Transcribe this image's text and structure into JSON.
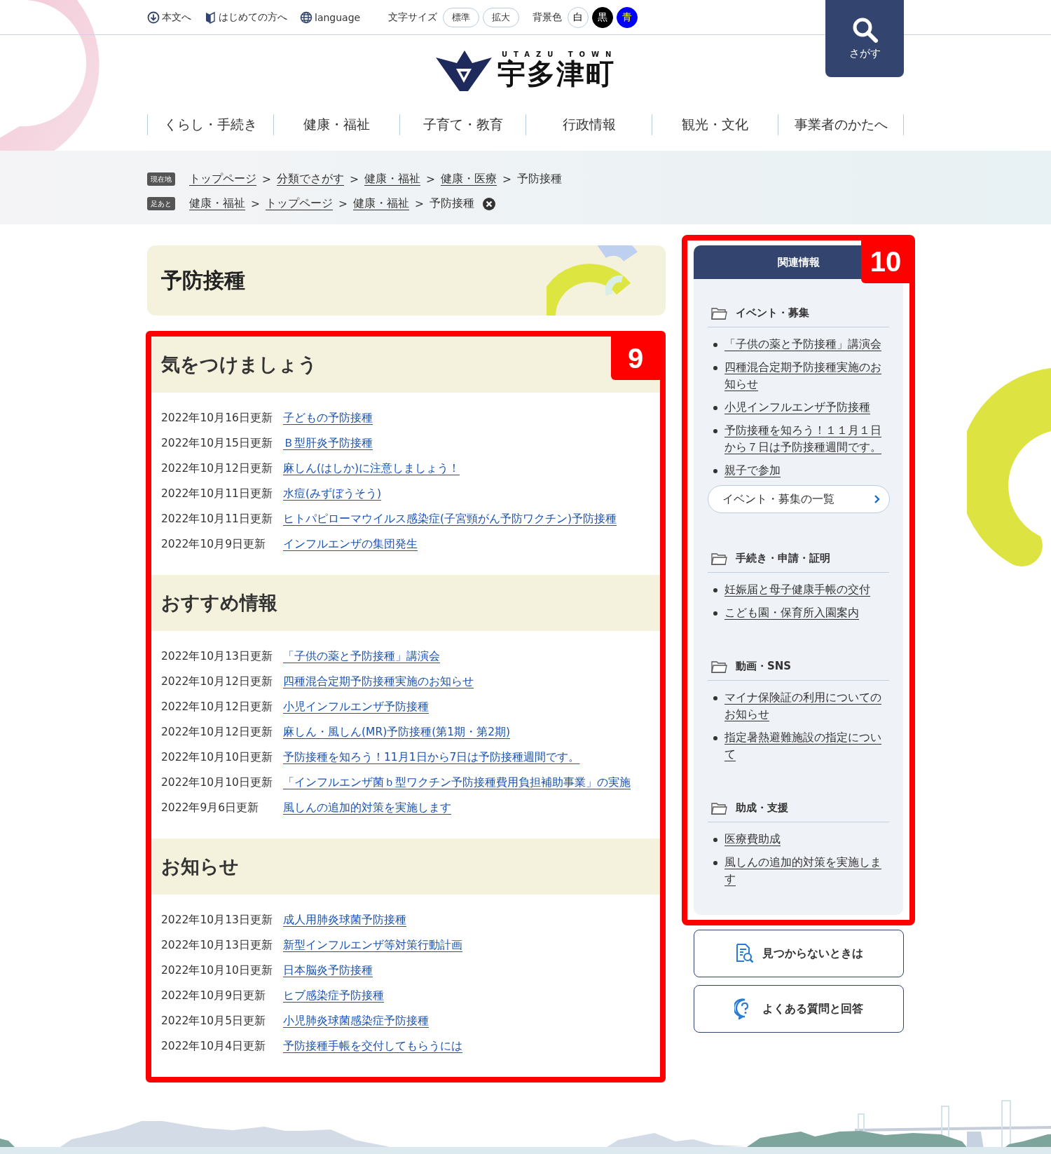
{
  "utility_bar": {
    "links": [
      {
        "label": "本文へ"
      },
      {
        "label": "はじめての方へ"
      },
      {
        "label": "language"
      }
    ],
    "font_size": {
      "label": "文字サイズ",
      "options": [
        {
          "label": "標準"
        },
        {
          "label": "拡大"
        }
      ]
    },
    "background_color": {
      "label": "背景色",
      "options": [
        {
          "label": "白",
          "color": "#ffffff"
        },
        {
          "label": "黒",
          "color": "#000000"
        },
        {
          "label": "青",
          "color": "#0000ff"
        }
      ]
    }
  },
  "search_button": {
    "label": "さがす"
  },
  "logo": {
    "tagline": "UTAZU TOWN",
    "name": "宇多津町"
  },
  "global_nav": [
    "くらし・手続き",
    "健康・福祉",
    "子育て・教育",
    "行政情報",
    "観光・文化",
    "事業者のかたへ"
  ],
  "breadcrumbs": [
    {
      "badge": "現在地",
      "separator": ">",
      "closable": false,
      "items": [
        {
          "label": "トップページ",
          "link": true
        },
        {
          "label": "分類でさがす",
          "link": true
        },
        {
          "label": "健康・福祉",
          "link": true
        },
        {
          "label": "健康・医療",
          "link": true
        },
        {
          "label": "予防接種",
          "link": false
        }
      ]
    },
    {
      "badge": "足あと",
      "separator": ">",
      "closable": true,
      "items": [
        {
          "label": "健康・福祉",
          "link": true
        },
        {
          "label": "トップページ",
          "link": true
        },
        {
          "label": "健康・福祉",
          "link": true
        },
        {
          "label": "予防接種",
          "link": false
        }
      ]
    }
  ],
  "page_title": "予防接種",
  "main_annotation": "9",
  "sections": [
    {
      "heading": "気をつけましょう",
      "items": [
        {
          "date": "2022年10月16日更新",
          "title": "子どもの予防接種"
        },
        {
          "date": "2022年10月15日更新",
          "title": "Ｂ型肝炎予防接種"
        },
        {
          "date": "2022年10月12日更新",
          "title": "麻しん(はしか)に注意しましょう！"
        },
        {
          "date": "2022年10月11日更新",
          "title": "水痘(みずぼうそう)"
        },
        {
          "date": "2022年10月11日更新",
          "title": "ヒトパピローマウイルス感染症(子宮頸がん予防ワクチン)予防接種"
        },
        {
          "date": "2022年10月9日更新",
          "title": "インフルエンザの集団発生"
        }
      ]
    },
    {
      "heading": "おすすめ情報",
      "items": [
        {
          "date": "2022年10月13日更新",
          "title": "「子供の薬と予防接種」講演会"
        },
        {
          "date": "2022年10月12日更新",
          "title": "四種混合定期予防接種実施のお知らせ"
        },
        {
          "date": "2022年10月12日更新",
          "title": "小児インフルエンザ予防接種"
        },
        {
          "date": "2022年10月12日更新",
          "title": "麻しん・風しん(MR)予防接種(第1期・第2期)"
        },
        {
          "date": "2022年10月10日更新",
          "title": "予防接種を知ろう！11月1日から7日は予防接種週間です。"
        },
        {
          "date": "2022年10月10日更新",
          "title": "「インフルエンザ菌ｂ型ワクチン予防接種費用負担補助事業」の実施"
        },
        {
          "date": "2022年9月6日更新",
          "title": "風しんの追加的対策を実施します"
        }
      ]
    },
    {
      "heading": "お知らせ",
      "items": [
        {
          "date": "2022年10月13日更新",
          "title": "成人用肺炎球菌予防接種"
        },
        {
          "date": "2022年10月13日更新",
          "title": "新型インフルエンザ等対策行動計画"
        },
        {
          "date": "2022年10月10日更新",
          "title": "日本脳炎予防接種"
        },
        {
          "date": "2022年10月9日更新",
          "title": "ヒブ感染症予防接種"
        },
        {
          "date": "2022年10月5日更新",
          "title": "小児肺炎球菌感染症予防接種"
        },
        {
          "date": "2022年10月4日更新",
          "title": "予防接種手帳を交付してもらうには"
        }
      ]
    }
  ],
  "sidebar": {
    "title": "関連情報",
    "annotation": "10",
    "groups": [
      {
        "heading": "イベント・募集",
        "links": [
          "「子供の薬と予防接種」講演会",
          "四種混合定期予防接種実施のお知らせ",
          "小児インフルエンザ予防接種",
          "予防接種を知ろう！１１月１日から７日は予防接種週間です。",
          "親子で参加"
        ],
        "more": "イベント・募集の一覧"
      },
      {
        "heading": "手続き・申請・証明",
        "links": [
          "妊娠届と母子健康手帳の交付",
          "こども園・保育所入園案内"
        ]
      },
      {
        "heading": "動画・SNS",
        "links": [
          "マイナ保険証の利用についてのお知らせ",
          "指定暑熱避難施設の指定について"
        ]
      },
      {
        "heading": "助成・支援",
        "links": [
          "医療費助成",
          "風しんの追加的対策を実施します"
        ]
      }
    ]
  },
  "help_buttons": [
    {
      "label": "見つからないときは"
    },
    {
      "label": "よくある質問と回答"
    }
  ]
}
